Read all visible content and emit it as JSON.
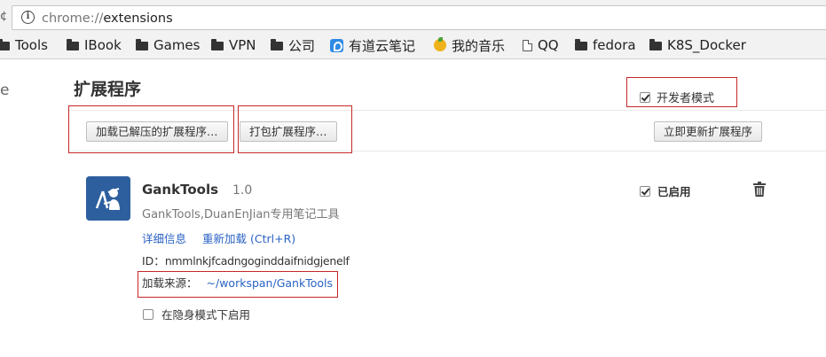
{
  "browser": {
    "reload_fragment": "¢",
    "info_icon": "ⓘ",
    "url_scheme": "chrome://",
    "url_host": "extensions"
  },
  "bookmarks": [
    {
      "label": "Tools",
      "icon": "folder-icon"
    },
    {
      "label": "IBook",
      "icon": "folder-icon"
    },
    {
      "label": "Games",
      "icon": "folder-icon"
    },
    {
      "label": "VPN",
      "icon": "folder-icon"
    },
    {
      "label": "公司",
      "icon": "folder-icon"
    },
    {
      "label": "有道云笔记",
      "icon": "youdao-icon"
    },
    {
      "label": "我的音乐",
      "icon": "music-icon"
    },
    {
      "label": "QQ",
      "icon": "page-icon"
    },
    {
      "label": "fedora",
      "icon": "folder-icon"
    },
    {
      "label": "K8S_Docker",
      "icon": "folder-icon"
    }
  ],
  "side_fragment": "e",
  "page": {
    "title": "扩展程序",
    "developer_mode_label": "开发者模式",
    "developer_mode_checked": true,
    "buttons": {
      "load_unpacked": "加载已解压的扩展程序…",
      "pack": "打包扩展程序…",
      "update_now": "立即更新扩展程序"
    }
  },
  "extension": {
    "name": "GankTools",
    "version": "1.0",
    "description": "GankTools,DuanEnJian专用笔记工具",
    "details_link": "详细信息",
    "reload_link": "重新加载 (Ctrl+R)",
    "id_label": "ID：",
    "id_value": "nmmlnkjfcadngoginddaifnidgjenelf",
    "source_label": "加载来源：",
    "source_path": "~/workspan/GankTools",
    "incognito_label": "在隐身模式下启用",
    "incognito_checked": false,
    "enabled_label": "已启用",
    "enabled_checked": true
  },
  "colors": {
    "link": "#2a62c4",
    "annotation": "#c62828",
    "extension_icon_bg": "#2d5f9e"
  }
}
